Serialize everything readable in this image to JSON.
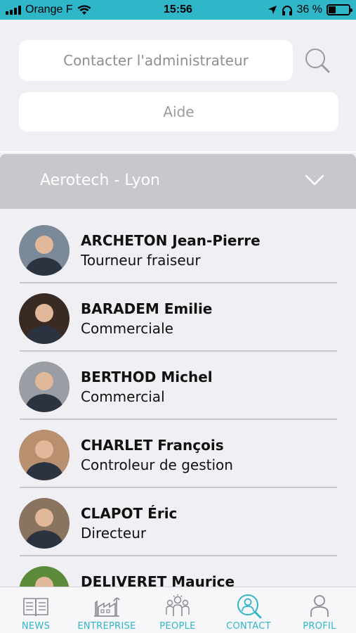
{
  "status_bar": {
    "carrier": "Orange F",
    "time": "15:56",
    "battery_percent": "36 %",
    "battery_level": 0.36
  },
  "search": {
    "placeholder": "Contacter l'administrateur",
    "icon": "search-icon"
  },
  "help": {
    "label": "Aide"
  },
  "site_selector": {
    "selected": "Aerotech - Lyon",
    "icon": "chevron-down-icon"
  },
  "people": [
    {
      "name": "ARCHETON Jean-Pierre",
      "role": "Tourneur fraiseur",
      "avatar_color": "#7a8a98"
    },
    {
      "name": "BARADEM Emilie",
      "role": "Commerciale",
      "avatar_color": "#3a2a24"
    },
    {
      "name": "BERTHOD Michel",
      "role": "Commercial",
      "avatar_color": "#9a9ea4"
    },
    {
      "name": "CHARLET François",
      "role": "Controleur de gestion",
      "avatar_color": "#b89070"
    },
    {
      "name": "CLAPOT Éric",
      "role": "Directeur",
      "avatar_color": "#8a7460"
    },
    {
      "name": "DELIVERET Maurice",
      "role": "",
      "avatar_color": "#5a8a3a"
    }
  ],
  "tabs": [
    {
      "label": "NEWS",
      "icon": "newspaper-icon",
      "active": false
    },
    {
      "label": "ENTREPRISE",
      "icon": "factory-icon",
      "active": false
    },
    {
      "label": "PEOPLE",
      "icon": "people-icon",
      "active": false
    },
    {
      "label": "CONTACT",
      "icon": "contact-search-icon",
      "active": true
    },
    {
      "label": "PROFIL",
      "icon": "profile-icon",
      "active": false
    }
  ],
  "colors": {
    "accent": "#2fb6c9",
    "background": "#efeff4",
    "dropdown": "#c8c8cc"
  }
}
